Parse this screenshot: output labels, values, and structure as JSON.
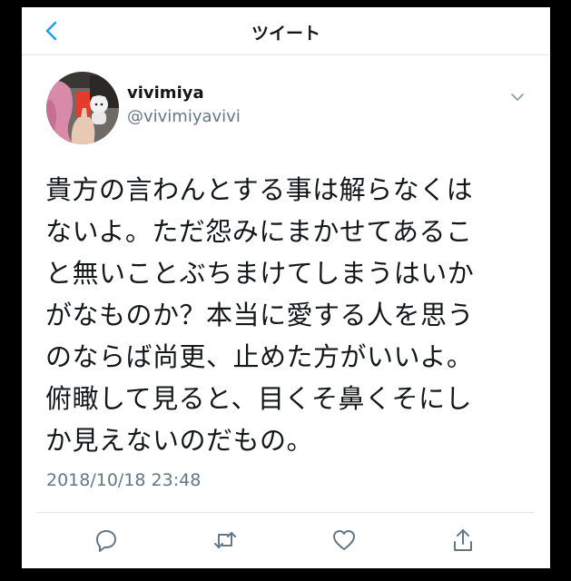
{
  "nav": {
    "title": "ツイート",
    "back_icon": "chevron-left-icon",
    "accent_color": "#1da1f2"
  },
  "tweet": {
    "display_name": "vivimiya",
    "handle": "@vivimiyavivi",
    "lines": [
      "貴方の言わんとする事は解らなくは",
      "ないよ。ただ怨みにまかせてあるこ",
      "と無いことぶちまけてしまうはいか",
      "がなものか？本当に愛する人を思う",
      "のならば尚更、止めた方がいいよ。",
      "俯瞰して見ると、目くそ鼻くそにし",
      "か見えないのだもの。"
    ],
    "timestamp": "2018/10/18 23:48"
  },
  "actions": {
    "reply_icon": "reply-icon",
    "retweet_icon": "retweet-icon",
    "like_icon": "heart-icon",
    "share_icon": "share-icon"
  },
  "colors": {
    "text": "#14171a",
    "secondary": "#657786",
    "border": "#e1e8ed",
    "background": "#ffffff",
    "frame": "#000000"
  }
}
